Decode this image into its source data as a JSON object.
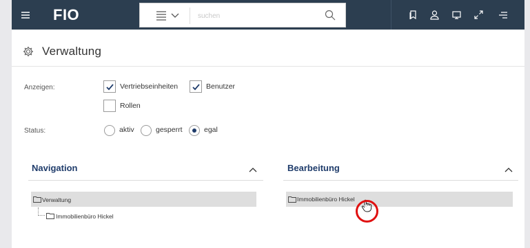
{
  "topbar": {
    "logo": "FIO",
    "search": {
      "placeholder": "suchen"
    },
    "icons": [
      "menu-icon",
      "list-icon",
      "chevron-down-icon",
      "search-icon",
      "bookmark-icon",
      "user-icon",
      "window-icon",
      "expand-icon",
      "menu-right-icon"
    ]
  },
  "page": {
    "title": "Verwaltung",
    "title_icon": "gear-icon"
  },
  "filters": {
    "anzeigen_label": "Anzeigen:",
    "checkboxes": [
      {
        "label": "Vertriebseinheiten",
        "checked": true
      },
      {
        "label": "Benutzer",
        "checked": true
      },
      {
        "label": "Rollen",
        "checked": false
      }
    ],
    "status_label": "Status:",
    "radios": [
      {
        "label": "aktiv",
        "checked": false
      },
      {
        "label": "gesperrt",
        "checked": false
      },
      {
        "label": "egal",
        "checked": true
      }
    ]
  },
  "navigation": {
    "title": "Navigation",
    "tree": [
      {
        "label": "Verwaltung",
        "level": 0,
        "selected": true
      },
      {
        "label": "Immobilienbüro Hickel",
        "level": 1,
        "selected": false
      }
    ]
  },
  "bearbeitung": {
    "title": "Bearbeitung",
    "tree": [
      {
        "label": "Immobilienbüro Hickel",
        "level": 0,
        "selected": true
      }
    ]
  },
  "colors": {
    "topbar": "#2c3e50",
    "accent": "#1f3c6b",
    "selected_row": "#dedede",
    "click_ring": "#e01010"
  }
}
